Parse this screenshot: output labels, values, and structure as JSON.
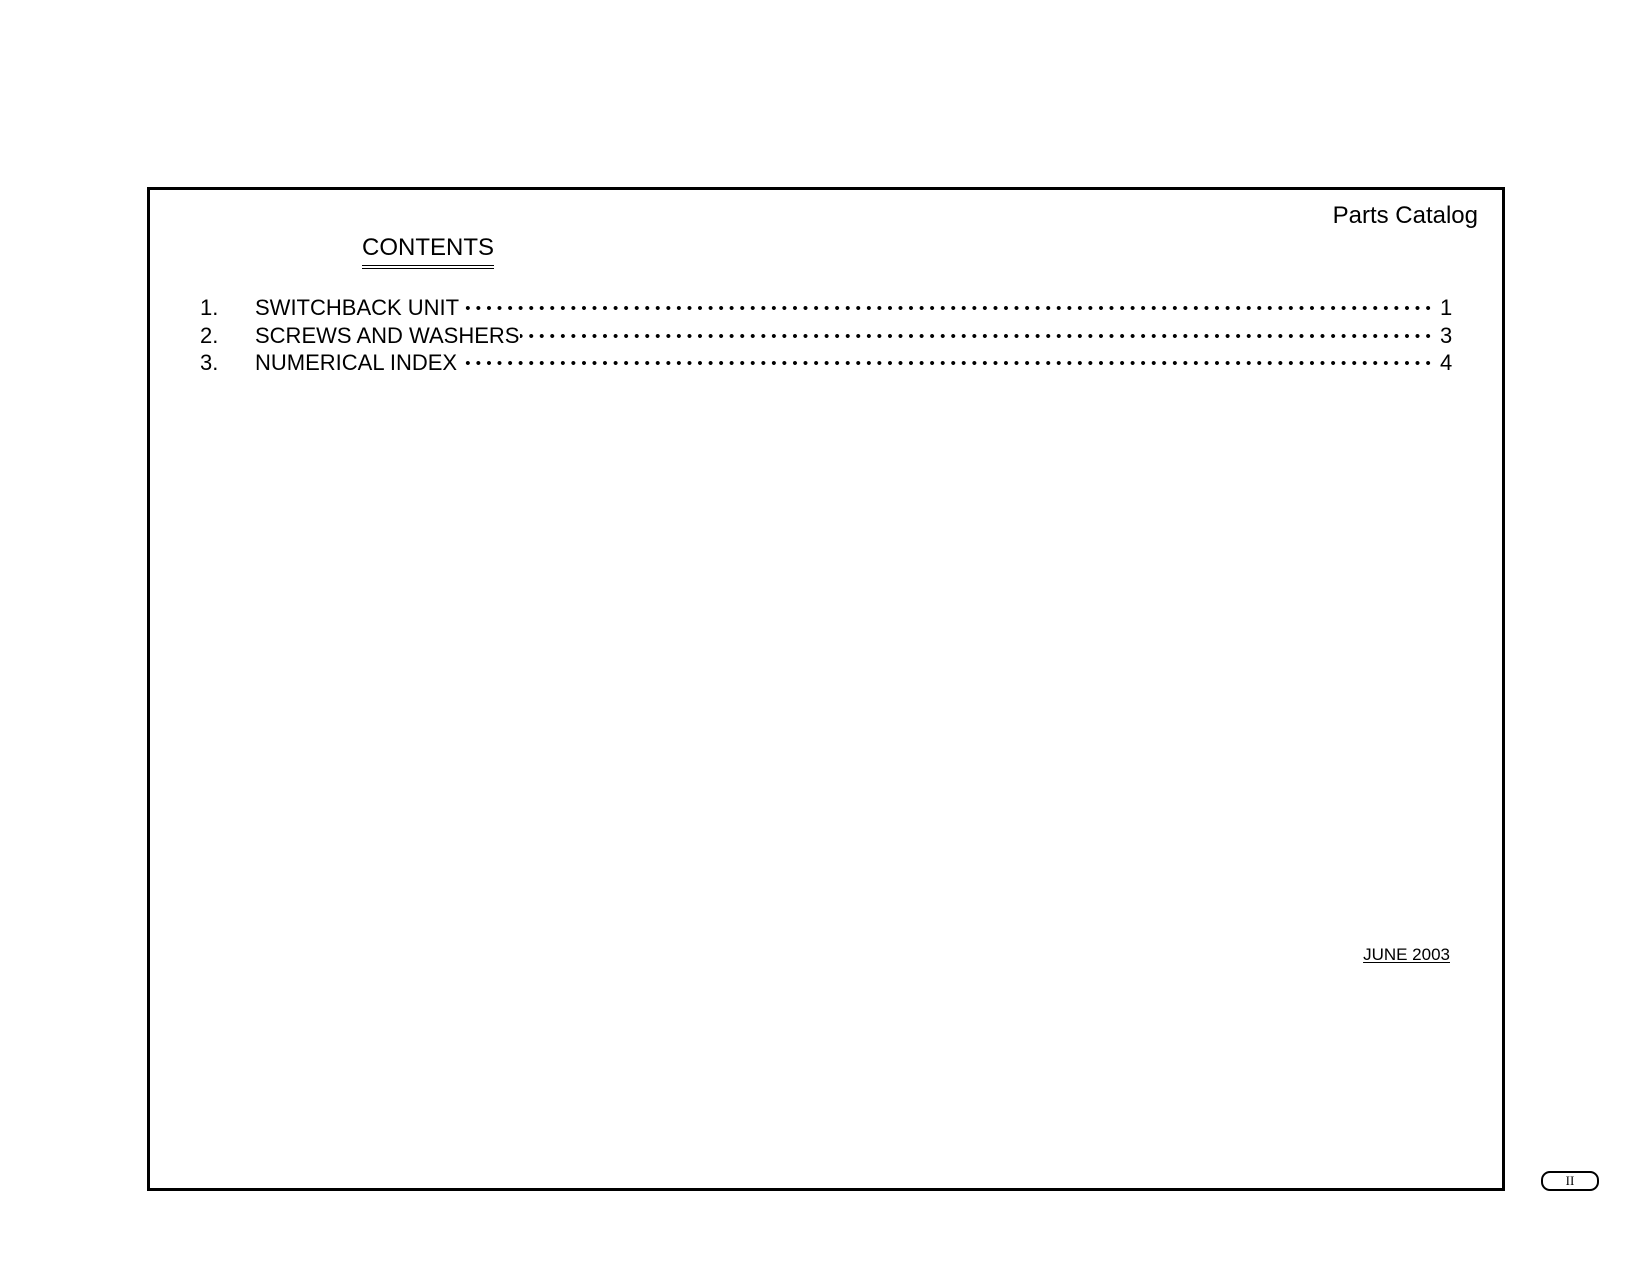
{
  "header": {
    "catalog_title": "Parts Catalog",
    "contents_heading": "CONTENTS"
  },
  "toc": {
    "entries": [
      {
        "number": "1.",
        "label": "SWITCHBACK UNIT",
        "page": "1"
      },
      {
        "number": "2.",
        "label": "SCREWS AND WASHERS",
        "page": "3"
      },
      {
        "number": "3.",
        "label": "NUMERICAL INDEX",
        "page": "4"
      }
    ],
    "leader_char": "•"
  },
  "footer": {
    "date": "JUNE 2003",
    "page_label": "II"
  }
}
